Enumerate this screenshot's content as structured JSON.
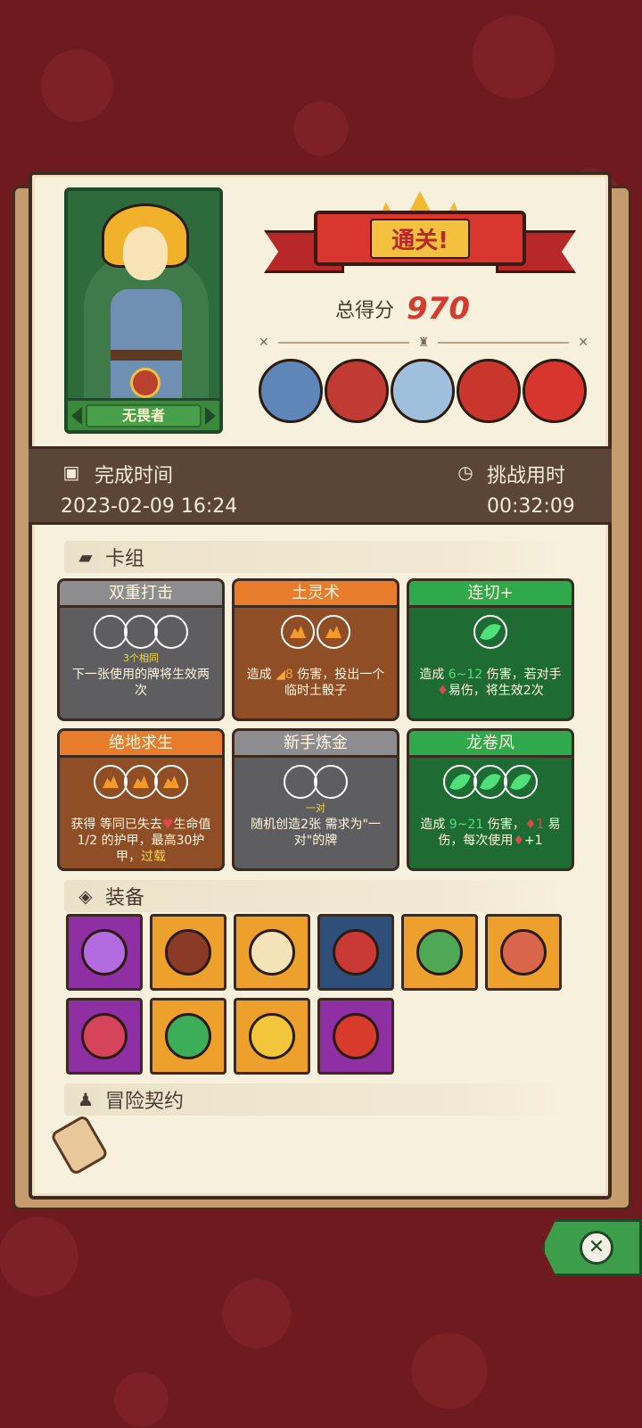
{
  "hero": {
    "name": "无畏者"
  },
  "result": {
    "banner": "通关!",
    "score_label": "总得分",
    "score": "970"
  },
  "bosses": [
    {
      "name": "boss-1",
      "color": "#5f86b8"
    },
    {
      "name": "boss-2",
      "color": "#c23a34"
    },
    {
      "name": "boss-3",
      "color": "#9fc0dd"
    },
    {
      "name": "boss-4",
      "color": "#c9372c"
    },
    {
      "name": "boss-5",
      "color": "#d8352f"
    }
  ],
  "times": {
    "complete_label": "完成时间",
    "complete_value": "2023-02-09 16:24",
    "challenge_label": "挑战用时",
    "challenge_value": "00:32:09"
  },
  "sections": {
    "deck": "卡组",
    "equipment": "装备",
    "contract": "冒险契约"
  },
  "cards": [
    {
      "title": "双重打击",
      "sub": "3个相同",
      "desc": "下一张使用的牌将生效两次"
    },
    {
      "title": "土灵术",
      "sub": "",
      "desc_pre": "造成",
      "desc_val": "8",
      "desc_post": "伤害，投出一个临时土骰子"
    },
    {
      "title": "连切+",
      "sub": "",
      "desc_pre": "造成",
      "desc_val": "6~12",
      "desc_post": "伤害，若对手",
      "desc_line2": "易伤，将生效2次"
    },
    {
      "title": "绝地求生",
      "sub": "",
      "desc_pre": "获得 等同已失去",
      "desc_mid": "生命值1/2 的护甲，最高30护甲，",
      "desc_hl": "过载"
    },
    {
      "title": "新手炼金",
      "sub": "一对",
      "desc": "随机创造2张 需求为\"一对\"的牌"
    },
    {
      "title": "龙卷风",
      "sub": "",
      "desc_pre": "造成",
      "desc_val": "9~21",
      "desc_post": "伤害，",
      "desc_val2": "1",
      "desc_mid2": "易伤，每次使用",
      "desc_val3": "+1"
    }
  ],
  "equipment": [
    {
      "name": "potion",
      "color": "#8e2fa4",
      "art": "#b36be0"
    },
    {
      "name": "shield-stone",
      "color": "#eda12c",
      "art": "#8a3a26"
    },
    {
      "name": "round-shield",
      "color": "#eda12c",
      "art": "#f4e2b8"
    },
    {
      "name": "dragon-staff",
      "color": "#2d4f7a",
      "art": "#c93a37"
    },
    {
      "name": "spell-book",
      "color": "#eda12c",
      "art": "#4fa855"
    },
    {
      "name": "ham",
      "color": "#eda12c",
      "art": "#d9664a"
    },
    {
      "name": "ruby-amulet",
      "color": "#8e2fa4",
      "art": "#d6445c"
    },
    {
      "name": "green-dragon",
      "color": "#eda12c",
      "art": "#3cae5a"
    },
    {
      "name": "crown",
      "color": "#eda12c",
      "art": "#f2c63a"
    },
    {
      "name": "red-boot",
      "color": "#8e2fa4",
      "art": "#d83a2c"
    }
  ]
}
